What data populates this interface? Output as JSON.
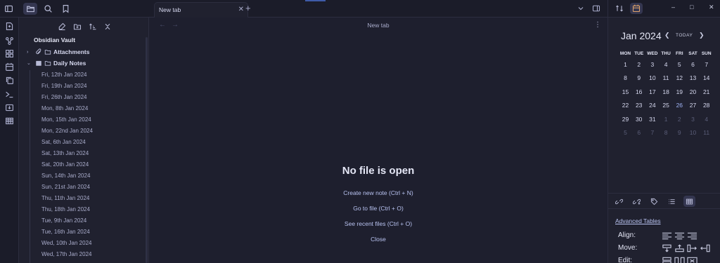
{
  "ribbon": {
    "icons": [
      "open-vault-icon",
      "graph-icon",
      "canvas-icon",
      "calendar-icon",
      "copy-icon",
      "terminal-icon",
      "import-icon",
      "table-icon"
    ]
  },
  "left_toolbar": {
    "icons": [
      "sidebar-toggle-icon",
      "file-explorer-icon",
      "search-icon",
      "bookmark-icon"
    ]
  },
  "explorer": {
    "actions": [
      "new-note-icon",
      "new-folder-icon",
      "sort-icon",
      "collapse-all-icon"
    ],
    "vault_name": "Obsidian Vault",
    "folders": [
      {
        "name": "Attachments",
        "expanded": false
      },
      {
        "name": "Daily Notes",
        "expanded": true
      }
    ],
    "files": [
      "Fri, 12th Jan 2024",
      "Fri, 19th Jan 2024",
      "Fri, 26th Jan 2024",
      "Mon, 8th Jan 2024",
      "Mon, 15th Jan 2024",
      "Mon, 22nd Jan 2024",
      "Sat, 6th Jan 2024",
      "Sat, 13th Jan 2024",
      "Sat, 20th Jan 2024",
      "Sun, 14th Jan 2024",
      "Sun, 21st Jan 2024",
      "Thu, 11th Jan 2024",
      "Thu, 18th Jan 2024",
      "Tue, 9th Jan 2024",
      "Tue, 16th Jan 2024",
      "Wed, 10th Jan 2024",
      "Wed, 17th Jan 2024"
    ]
  },
  "tabs": {
    "active_label": "New tab",
    "close_glyph": "✕",
    "new_tab_glyph": "+"
  },
  "main": {
    "view_title": "New tab",
    "empty_title": "No file is open",
    "actions": [
      "Create new note (Ctrl + N)",
      "Go to file (Ctrl + O)",
      "See recent files (Ctrl + O)",
      "Close"
    ]
  },
  "window_controls": {
    "minimize": "–",
    "maximize": "□",
    "close": "✕"
  },
  "calendar": {
    "month": "Jan",
    "year": "2024",
    "today_label": "TODAY",
    "weekdays": [
      "MON",
      "TUE",
      "WED",
      "THU",
      "FRI",
      "SAT",
      "SUN"
    ],
    "weeks": [
      [
        "1",
        "2",
        "3",
        "4",
        "5",
        "6",
        "7"
      ],
      [
        "8",
        "9",
        "10",
        "11",
        "12",
        "13",
        "14"
      ],
      [
        "15",
        "16",
        "17",
        "18",
        "19",
        "20",
        "21"
      ],
      [
        "22",
        "23",
        "24",
        "25",
        "26",
        "27",
        "28"
      ],
      [
        "29",
        "30",
        "31",
        "1",
        "2",
        "3",
        "4"
      ],
      [
        "5",
        "6",
        "7",
        "8",
        "9",
        "10",
        "11"
      ]
    ],
    "today": "26"
  },
  "advanced_tables": {
    "title": "Advanced Tables",
    "rows": [
      {
        "label": "Align:"
      },
      {
        "label": "Move:"
      },
      {
        "label": "Edit:"
      }
    ]
  },
  "colors": {
    "accent": "#3e5ba8",
    "link": "#b8c2f0",
    "calendar_active": "#e0a36b"
  }
}
